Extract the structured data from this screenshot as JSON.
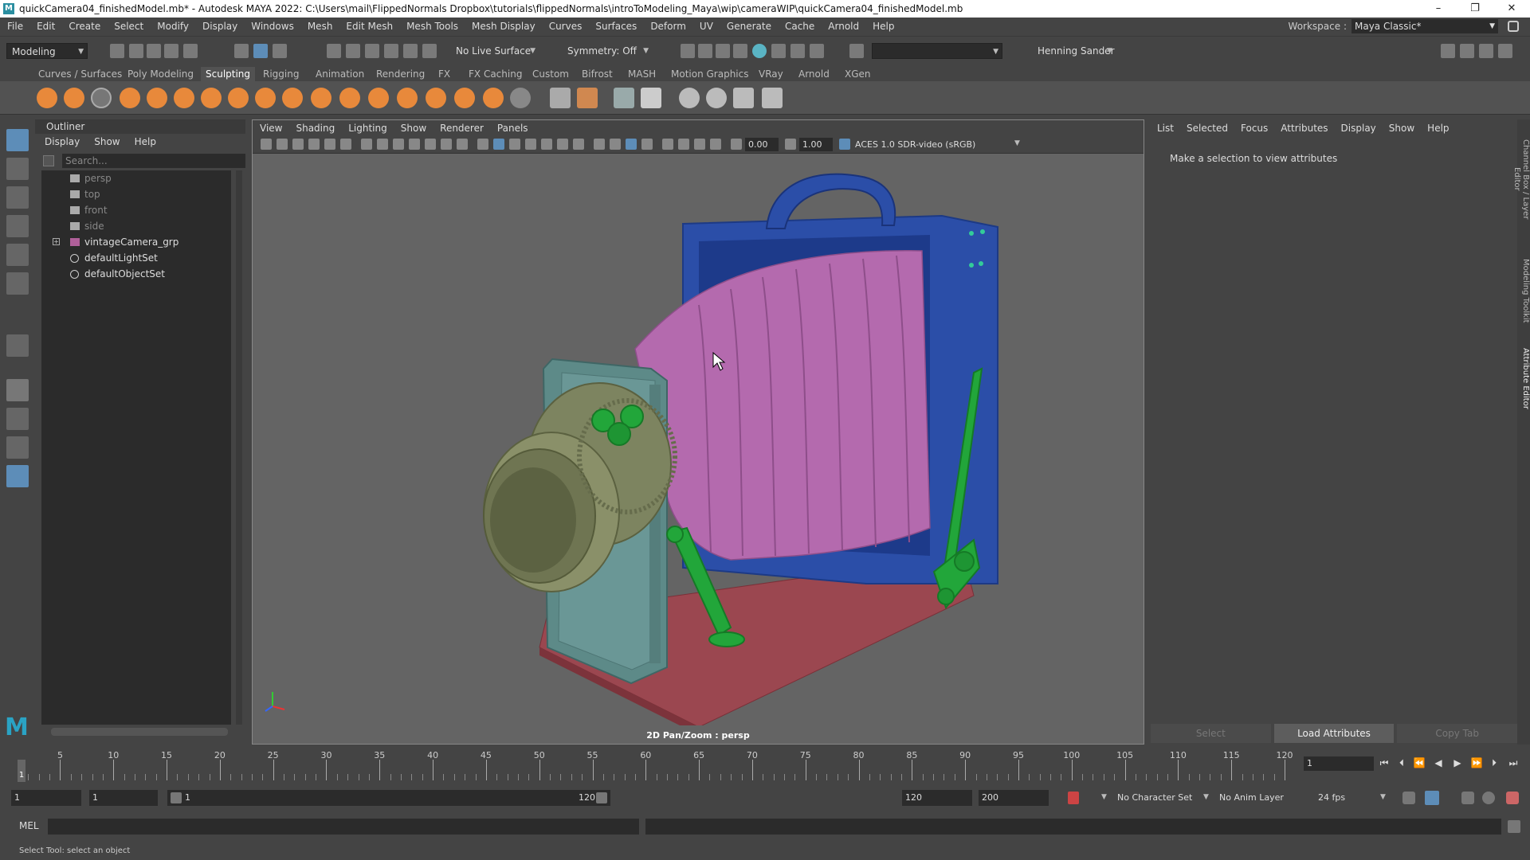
{
  "window": {
    "title": "quickCamera04_finishedModel.mb* - Autodesk MAYA 2022: C:\\Users\\mail\\FlippedNormals Dropbox\\tutorials\\flippedNormals\\introToModeling_Maya\\wip\\cameraWIP\\quickCamera04_finishedModel.mb",
    "minimize": "–",
    "restore": "❐",
    "close": "✕"
  },
  "menubar": [
    "File",
    "Edit",
    "Create",
    "Select",
    "Modify",
    "Display",
    "Windows",
    "Mesh",
    "Edit Mesh",
    "Mesh Tools",
    "Mesh Display",
    "Curves",
    "Surfaces",
    "Deform",
    "UV",
    "Generate",
    "Cache",
    "Arnold",
    "Help"
  ],
  "workspace": {
    "label": "Workspace :",
    "value": "Maya Classic*"
  },
  "statusline": {
    "menuset": "Modeling",
    "live_surface": "No Live Surface",
    "symmetry": "Symmetry: Off",
    "user": "Henning Sander"
  },
  "shelf_tabs": [
    "Curves / Surfaces",
    "Poly Modeling",
    "Sculpting",
    "Rigging",
    "Animation",
    "Rendering",
    "FX",
    "FX Caching",
    "Custom",
    "Bifrost",
    "MASH",
    "Motion Graphics",
    "VRay",
    "Arnold",
    "XGen"
  ],
  "shelf_active": "Sculpting",
  "outliner": {
    "title": "Outliner",
    "menu": [
      "Display",
      "Show",
      "Help"
    ],
    "search_placeholder": "Search...",
    "items": [
      {
        "label": "persp",
        "dim": true,
        "icon": "camera-icon"
      },
      {
        "label": "top",
        "dim": true,
        "icon": "camera-icon"
      },
      {
        "label": "front",
        "dim": true,
        "icon": "camera-icon"
      },
      {
        "label": "side",
        "dim": true,
        "icon": "camera-icon"
      },
      {
        "label": "vintageCamera_grp",
        "dim": false,
        "icon": "group-icon"
      },
      {
        "label": "defaultLightSet",
        "dim": false,
        "icon": "set-icon"
      },
      {
        "label": "defaultObjectSet",
        "dim": false,
        "icon": "set-icon"
      }
    ]
  },
  "viewport": {
    "menu": [
      "View",
      "Shading",
      "Lighting",
      "Show",
      "Renderer",
      "Panels"
    ],
    "near_value": "0.00",
    "gamma_value": "1.00",
    "colorspace": "ACES 1.0 SDR-video (sRGB)",
    "camera_label": "2D Pan/Zoom : persp"
  },
  "attribute_editor": {
    "menu": [
      "List",
      "Selected",
      "Focus",
      "Attributes",
      "Display",
      "Show",
      "Help"
    ],
    "message": "Make a selection to view attributes",
    "buttons": [
      "Select",
      "Load Attributes",
      "Copy Tab"
    ]
  },
  "side_tabs": [
    "Channel Box / Layer Editor",
    "Modeling Toolkit",
    "Attribute Editor"
  ],
  "timeline": {
    "labels": [
      "1",
      "5",
      "10",
      "15",
      "20",
      "25",
      "30",
      "35",
      "40",
      "45",
      "50",
      "55",
      "60",
      "65",
      "70",
      "75",
      "80",
      "85",
      "90",
      "95",
      "100",
      "105",
      "110",
      "115",
      "120"
    ],
    "current_frame": "1"
  },
  "range": {
    "start": "1",
    "playback_start": "1",
    "slider_start": "1",
    "slider_end": "120",
    "playback_end": "120",
    "end": "200",
    "character_set": "No Character Set",
    "anim_layer": "No Anim Layer",
    "fps": "24 fps"
  },
  "command_line": {
    "label": "MEL"
  },
  "help_line": "Select Tool: select an object",
  "colors": {
    "shelf_orange": "#e8893b",
    "active_blue": "#5d8db8",
    "bg": "#444444",
    "viewport": "#646464"
  }
}
